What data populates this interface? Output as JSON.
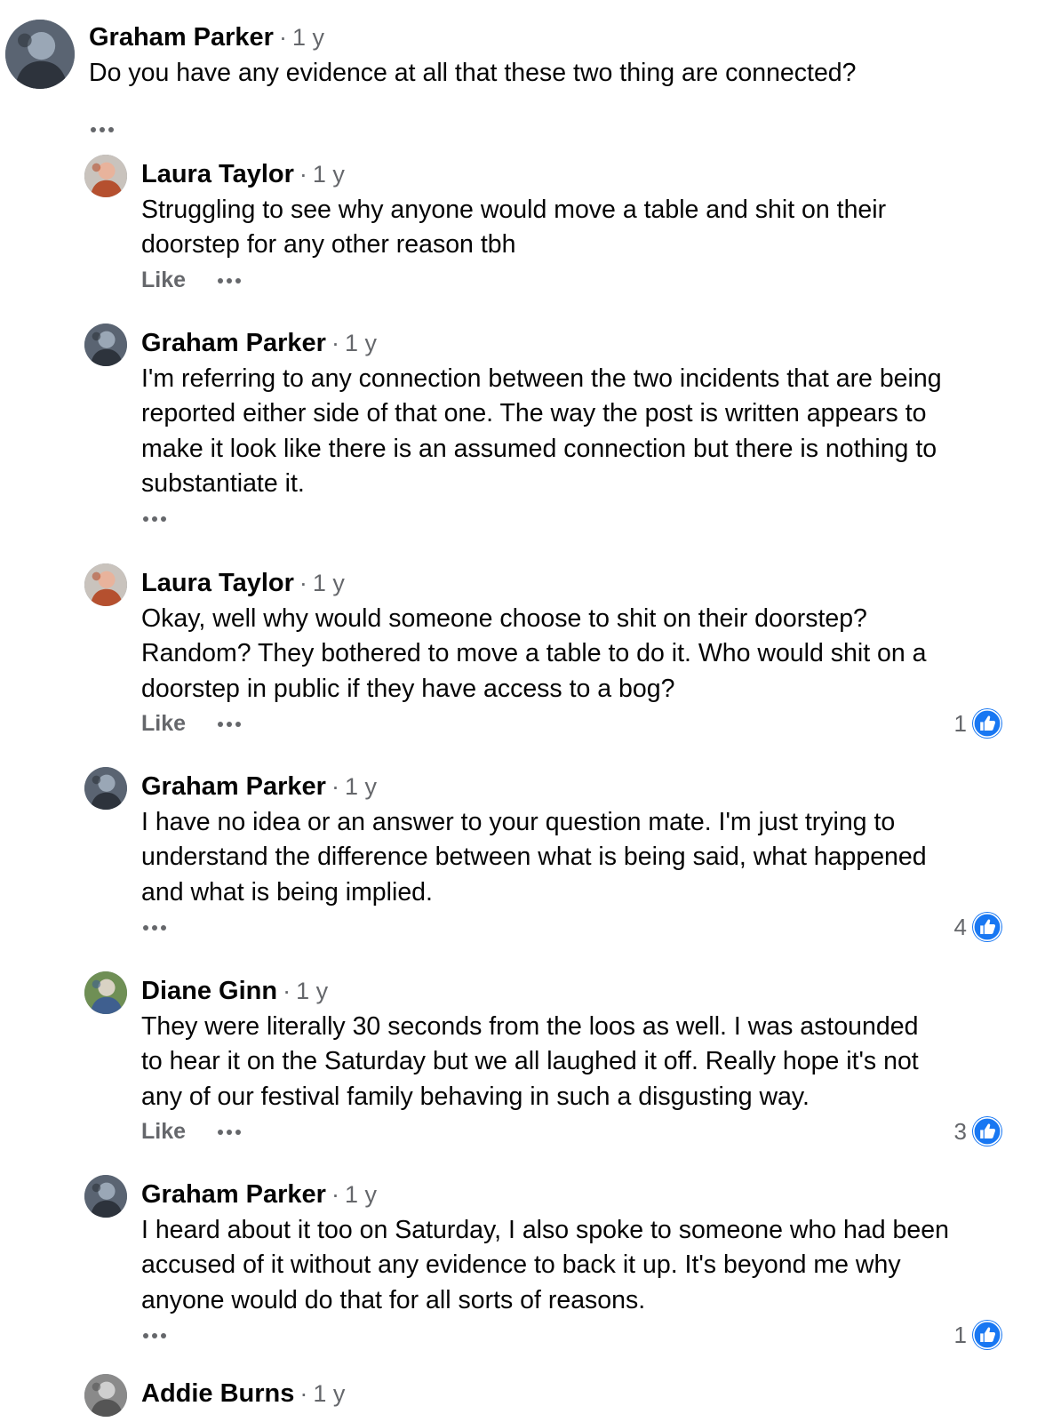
{
  "ui": {
    "like_label": "Like",
    "separator": "·",
    "accent_color": "#1877f2",
    "icons": {
      "more": "more-options-icon",
      "reaction": "thumbs-up-reaction-icon"
    }
  },
  "comments": [
    {
      "author": "Graham Parker",
      "time": "1 y",
      "text": "Do you have any evidence at all that these two thing are connected?",
      "show_like": false,
      "reaction_count": null
    },
    {
      "author": "Laura Taylor",
      "time": "1 y",
      "text": "Struggling to see why anyone would move a table and shit on their\ndoorstep for any other reason tbh",
      "show_like": true,
      "reaction_count": null
    },
    {
      "author": "Graham Parker",
      "time": "1 y",
      "text": "I'm referring to any connection between the two incidents that are being\nreported either side of that one. The way the post is written appears to\nmake it look like there is an assumed connection but there is nothing to\nsubstantiate it.",
      "show_like": false,
      "reaction_count": null
    },
    {
      "author": "Laura Taylor",
      "time": "1 y",
      "text": "Okay, well why would someone choose to shit on their doorstep?\nRandom? They bothered to move a table to do it. Who would shit on a\ndoorstep in public if they have access to a bog?",
      "show_like": true,
      "reaction_count": "1"
    },
    {
      "author": "Graham Parker",
      "time": "1 y",
      "text": "I have no idea or an answer to your question mate. I'm just trying to\nunderstand the difference between what is being said, what happened\nand what is being implied.",
      "show_like": false,
      "reaction_count": "4"
    },
    {
      "author": "Diane Ginn",
      "time": "1 y",
      "text": "They were literally 30 seconds from the loos as well.  I was astounded\nto hear it on the Saturday but we all laughed it off.  Really hope it's not\nany of our festival family behaving in such a disgusting way.",
      "show_like": true,
      "reaction_count": "3"
    },
    {
      "author": "Graham Parker",
      "time": "1 y",
      "text": "I heard about it too on Saturday, I also spoke to someone who had been\naccused of it without any evidence to back it up. It's beyond me why\nanyone would do that for all sorts of reasons.",
      "show_like": false,
      "reaction_count": "1"
    },
    {
      "author": "Addie Burns",
      "time": "1 y",
      "text": "",
      "show_like": false,
      "reaction_count": null
    }
  ]
}
